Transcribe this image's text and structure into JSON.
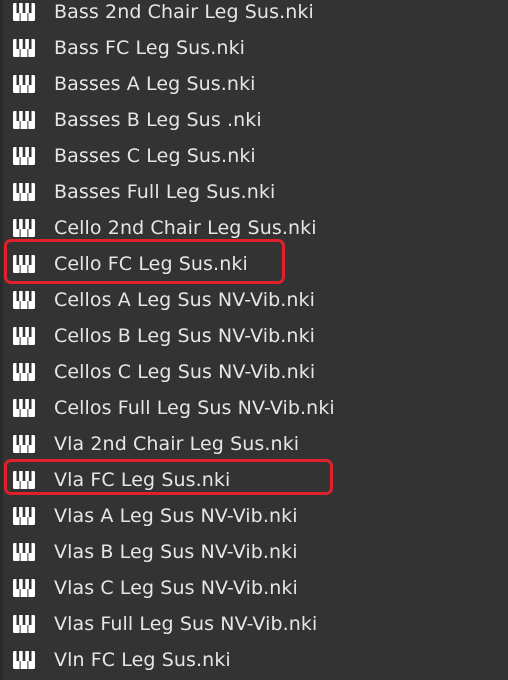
{
  "file_list": {
    "items": [
      {
        "label": "Bass 2nd Chair Leg Sus.nki",
        "icon": "instrument-file-icon"
      },
      {
        "label": "Bass FC Leg Sus.nki",
        "icon": "instrument-file-icon"
      },
      {
        "label": "Basses A Leg Sus.nki",
        "icon": "instrument-file-icon"
      },
      {
        "label": "Basses B Leg Sus .nki",
        "icon": "instrument-file-icon"
      },
      {
        "label": "Basses C Leg Sus.nki",
        "icon": "instrument-file-icon"
      },
      {
        "label": "Basses Full Leg Sus.nki",
        "icon": "instrument-file-icon"
      },
      {
        "label": "Cello 2nd Chair Leg Sus.nki",
        "icon": "instrument-file-icon"
      },
      {
        "label": "Cello FC Leg Sus.nki",
        "icon": "instrument-file-icon",
        "highlighted": true
      },
      {
        "label": "Cellos A Leg Sus NV-Vib.nki",
        "icon": "instrument-file-icon"
      },
      {
        "label": "Cellos B Leg Sus NV-Vib.nki",
        "icon": "instrument-file-icon"
      },
      {
        "label": "Cellos C Leg Sus NV-Vib.nki",
        "icon": "instrument-file-icon"
      },
      {
        "label": "Cellos Full Leg Sus NV-Vib.nki",
        "icon": "instrument-file-icon"
      },
      {
        "label": "Vla 2nd Chair Leg Sus.nki",
        "icon": "instrument-file-icon"
      },
      {
        "label": "Vla FC Leg Sus.nki",
        "icon": "instrument-file-icon",
        "highlighted": true
      },
      {
        "label": "Vlas A Leg Sus NV-Vib.nki",
        "icon": "instrument-file-icon"
      },
      {
        "label": "Vlas B Leg Sus NV-Vib.nki",
        "icon": "instrument-file-icon"
      },
      {
        "label": "Vlas C Leg Sus NV-Vib.nki",
        "icon": "instrument-file-icon"
      },
      {
        "label": "Vlas Full Leg Sus NV-Vib.nki",
        "icon": "instrument-file-icon"
      },
      {
        "label": "Vln FC Leg Sus.nki",
        "icon": "instrument-file-icon"
      }
    ]
  },
  "colors": {
    "background": "#333333",
    "text": "#e6e6e6",
    "highlight_border": "#e0212b"
  }
}
